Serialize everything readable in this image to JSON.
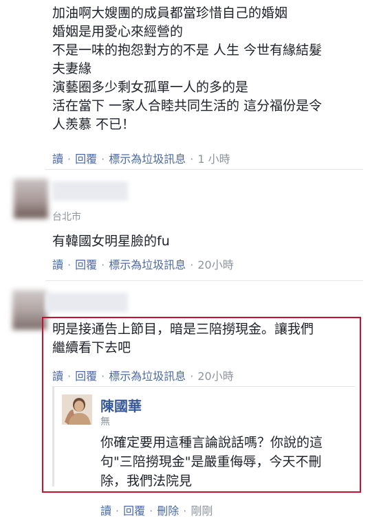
{
  "comment1": {
    "lines": [
      "加油啊大嫂團的成員都當珍惜自己的婚姻",
      "婚姻是用愛心來經營的",
      "不是一味的抱怨對方的不是 人生 今世有緣結髮",
      "夫妻緣",
      "演藝圈多少剩女孤單一人的多的是",
      "活在當下 一家人合睦共同生活的 這分福份是令",
      "人羨慕 不已！"
    ],
    "actions": {
      "read": "讀",
      "reply": "回覆",
      "spam": "標示為垃圾訊息",
      "time": "1 小時"
    }
  },
  "comment2": {
    "location": "台北市",
    "text": "有韓國女明星臉的fu",
    "actions": {
      "read": "讀",
      "reply": "回覆",
      "spam": "標示為垃圾訊息",
      "time": "20小時"
    }
  },
  "comment3": {
    "lines": [
      "明是接通告上節目，暗是三陪撈現金。讓我們",
      "繼續看下去吧"
    ],
    "actions": {
      "read": "讀",
      "reply": "回覆",
      "spam": "標示為垃圾訊息",
      "time": "20小時"
    }
  },
  "reply": {
    "name": "陳國華",
    "subtitle": "無",
    "lines": [
      "你確定要用這種言論說話嗎？你說的這",
      "句\"三陪撈現金\"是嚴重侮辱，今天不刪",
      "除，我們法院見"
    ],
    "actions": {
      "read": "讀",
      "reply": "回覆",
      "delete": "刪除",
      "time": "剛剛"
    }
  }
}
